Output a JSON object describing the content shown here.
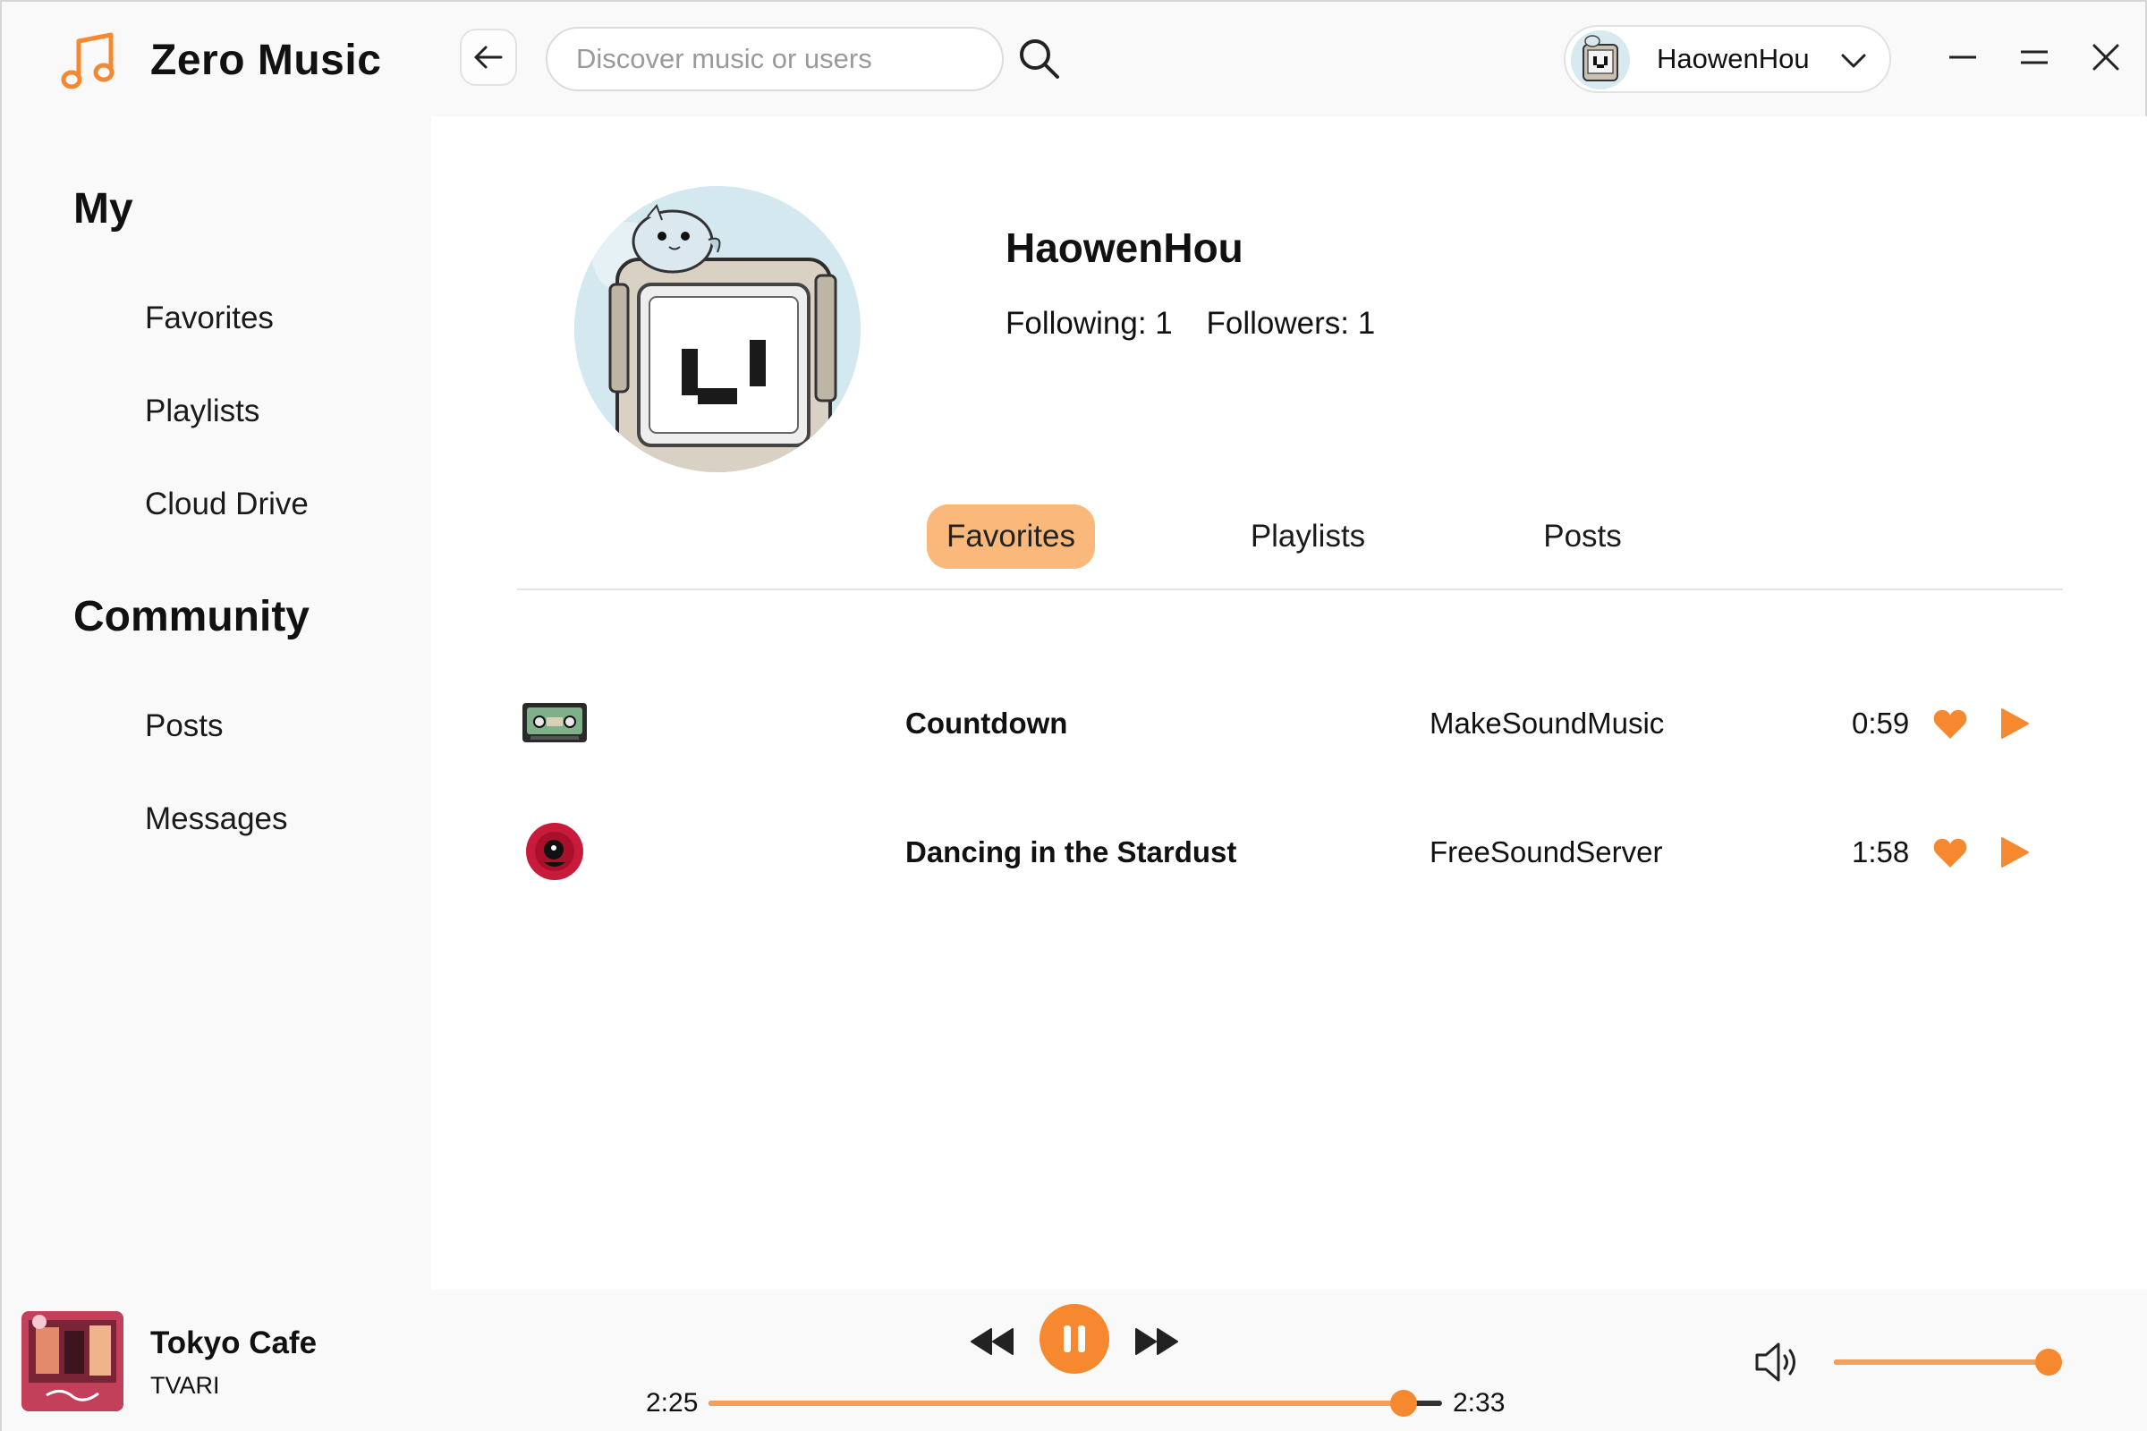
{
  "app": {
    "name": "Zero Music",
    "logo_icon": "music-note-icon",
    "accent_color": "#f6882f",
    "accent_light": "#fab97a"
  },
  "search": {
    "placeholder": "Discover music or users"
  },
  "user_menu": {
    "username": "HaowenHou"
  },
  "sidebar": {
    "my_title": "My",
    "my_items": [
      {
        "label": "Favorites"
      },
      {
        "label": "Playlists"
      },
      {
        "label": "Cloud Drive"
      }
    ],
    "community_title": "Community",
    "community_items": [
      {
        "label": "Posts"
      },
      {
        "label": "Messages"
      }
    ]
  },
  "profile": {
    "name": "HaowenHou",
    "following": "Following: 1",
    "followers": "Followers: 1"
  },
  "tabs": [
    {
      "label": "Favorites",
      "active": true
    },
    {
      "label": "Playlists",
      "active": false
    },
    {
      "label": "Posts",
      "active": false
    }
  ],
  "songs": [
    {
      "title": "Countdown",
      "artist": "MakeSoundMusic",
      "duration": "0:59",
      "favorited": true
    },
    {
      "title": "Dancing in the Stardust",
      "artist": "FreeSoundServer",
      "duration": "1:58",
      "favorited": true
    }
  ],
  "player": {
    "title": "Tokyo Cafe",
    "artist": "TVARI",
    "current_time": "2:25",
    "total_time": "2:33",
    "progress_fraction": 0.948,
    "volume_fraction": 1.0,
    "state": "playing"
  }
}
